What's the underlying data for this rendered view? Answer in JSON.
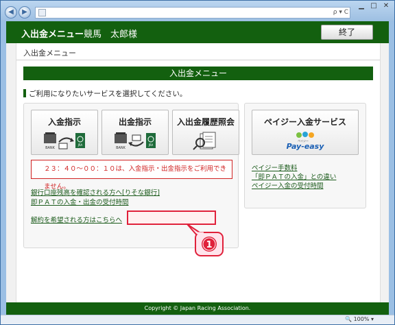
{
  "browser": {
    "address_text": "",
    "address_right": "ρ ▾ C",
    "zoom": "100%"
  },
  "header": {
    "title": "入出金メニュー",
    "user": "競馬　太郎様",
    "exit_label": "終了"
  },
  "breadcrumb": "入出金メニュー",
  "section_title": "入出金メニュー",
  "instruction": "ご利用になりたいサービスを選択してください。",
  "actions": [
    {
      "label": "入金指示"
    },
    {
      "label": "出金指示"
    },
    {
      "label": "入出金履歴照会"
    }
  ],
  "icon_texts": {
    "bank": "BANK",
    "jra": "JRA"
  },
  "warning": "２３：４０～００：１０は、入金指示・出金指示をご利用できません。",
  "links_left": [
    "銀行口座残高を確認される方へ[りそな銀行]",
    "即ＰＡＴの入金・出金の受付時間"
  ],
  "cancel_link": "解約を希望される方はこちらへ",
  "payeasy": {
    "button_label": "ペイジー入金サービス",
    "logo_text": "Pay-easy",
    "logo_sub": "ペイジー",
    "links": [
      "ペイジー手数料",
      "「即ＰＡＴの入金」との違い",
      "ペイジー入金の受付時間"
    ]
  },
  "callout_number": "1",
  "footer": "Copyright © Japan Racing Association.",
  "colors": {
    "brand_green": "#13600f",
    "warning_red": "#d02020",
    "highlight_red": "#e0203a"
  }
}
